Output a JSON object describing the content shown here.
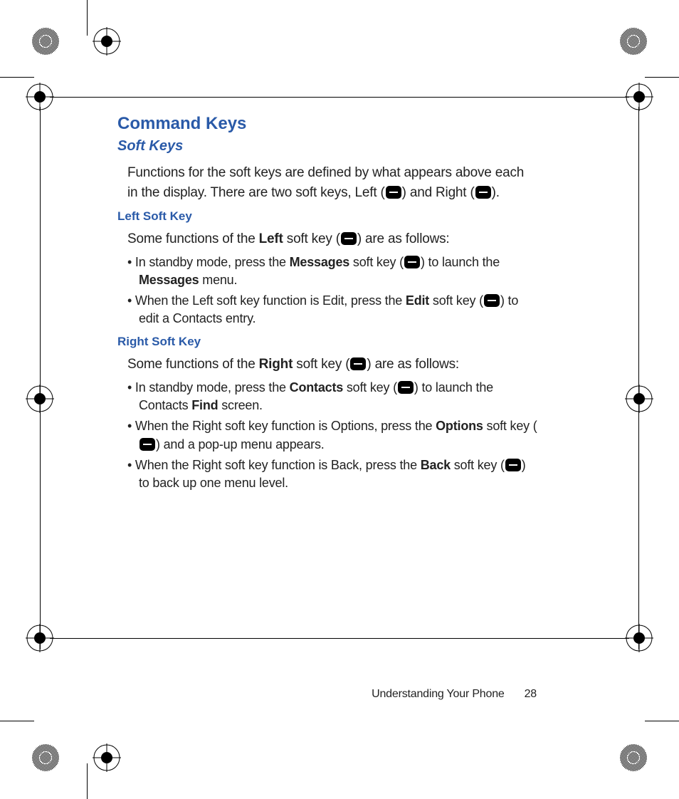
{
  "headings": {
    "h1": "Command Keys",
    "h2": "Soft Keys",
    "left": "Left Soft Key",
    "right": "Right Soft Key"
  },
  "intro": {
    "line1": "Functions for the soft keys are defined by what appears above each",
    "line2a": "in the display. There are two soft keys, Left (",
    "line2b": ")  and Right (",
    "line2c": ")."
  },
  "left": {
    "intro_a": "Some functions of the ",
    "intro_b": "Left",
    "intro_c": " soft key (",
    "intro_d": ") are as follows:",
    "li1_a": "In standby mode, press the ",
    "li1_b": "Messages",
    "li1_c": " soft key (",
    "li1_d": ") to launch the ",
    "li1_e": "Messages",
    "li1_f": " menu.",
    "li2_a": "When the Left soft key function is Edit, press the ",
    "li2_b": "Edit",
    "li2_c": " soft key (",
    "li2_d": ") to edit a Contacts entry."
  },
  "right": {
    "intro_a": "Some functions of the ",
    "intro_b": "Right",
    "intro_c": " soft key (",
    "intro_d": ") are as follows:",
    "li1_a": "In standby mode, press the ",
    "li1_b": "Contacts",
    "li1_c": " soft key (",
    "li1_d": ") to launch the Contacts ",
    "li1_e": "Find",
    "li1_f": " screen.",
    "li2_a": "When the Right soft key function is Options, press the ",
    "li2_b": "Options",
    "li2_c": " soft key (",
    "li2_d": ") and a pop-up menu appears.",
    "li3_a": "When the Right soft key function is Back, press the ",
    "li3_b": "Back",
    "li3_c": " soft key (",
    "li3_d": ") to back up one menu level."
  },
  "footer": {
    "section": "Understanding Your Phone",
    "page": "28"
  }
}
